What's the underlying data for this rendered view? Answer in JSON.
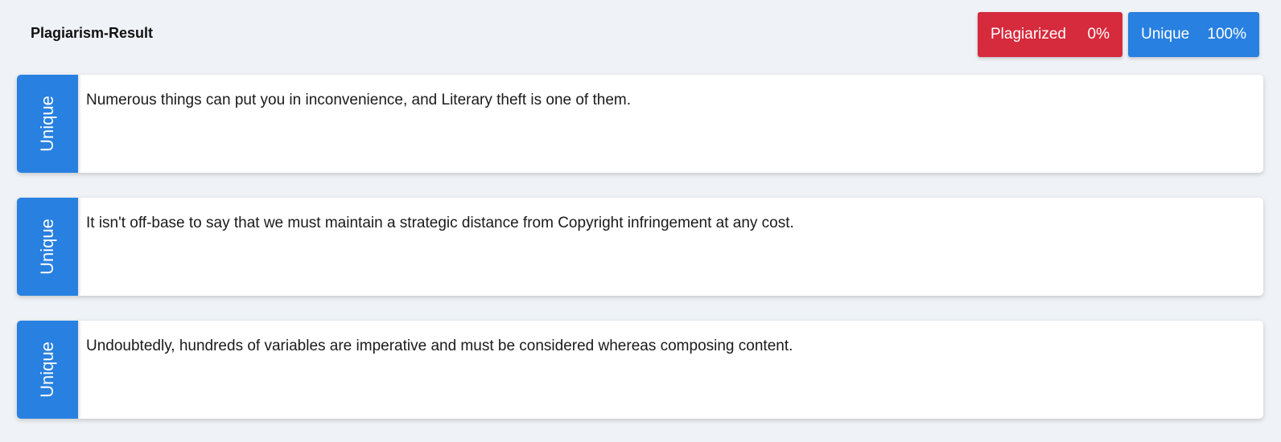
{
  "header": {
    "title": "Plagiarism-Result"
  },
  "summary": {
    "plagiarized": {
      "label": "Plagiarized",
      "value": "0%",
      "color": "#d62a3d"
    },
    "unique": {
      "label": "Unique",
      "value": "100%",
      "color": "#2880e0"
    }
  },
  "results": [
    {
      "status": "Unique",
      "text": "Numerous things can put you in inconvenience, and Literary theft is one of them."
    },
    {
      "status": "Unique",
      "text": "It isn't off-base to say that we must maintain a strategic distance from Copyright infringement at any cost."
    },
    {
      "status": "Unique",
      "text": "Undoubtedly, hundreds of variables are imperative and must be considered whereas composing content."
    }
  ]
}
